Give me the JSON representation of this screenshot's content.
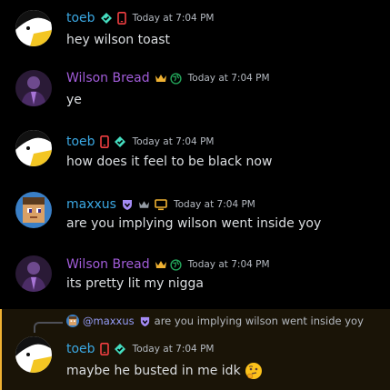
{
  "colors": {
    "toeb": "#3ba8e3",
    "wilson": "#a15cd9",
    "maxxus": "#3ba8e3",
    "timestamp": "#b5bac1",
    "reply_highlight": "#f0b232"
  },
  "icons": [
    "verified-diamond-icon",
    "mobile-phone-icon",
    "crown-icon",
    "globe-icon",
    "nitro-shield-icon",
    "computer-icon",
    "thinking-emoji-icon"
  ],
  "messages": [
    {
      "username": "toeb",
      "timestamp": "Today at 7:04 PM",
      "content": "hey wilson toast"
    },
    {
      "username": "Wilson Bread",
      "timestamp": "Today at 7:04 PM",
      "content": "ye"
    },
    {
      "username": "toeb",
      "timestamp": "Today at 7:04 PM",
      "content": "how does it feel to be black now"
    },
    {
      "username": "maxxus",
      "timestamp": "Today at 7:04 PM",
      "content": "are you implying wilson went inside yoy"
    },
    {
      "username": "Wilson Bread",
      "timestamp": "Today at 7:04 PM",
      "content": "its pretty lit my nigga"
    },
    {
      "username": "toeb",
      "timestamp": "Today at 7:04 PM",
      "content": "maybe he busted in me idk",
      "reply": {
        "mention": "@maxxus",
        "text": "are you implying wilson went inside yoy"
      }
    }
  ]
}
